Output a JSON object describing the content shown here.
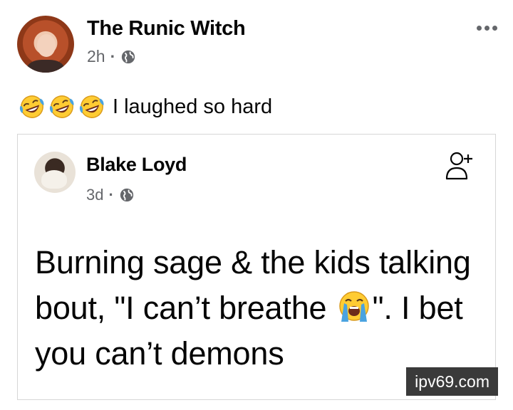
{
  "post": {
    "author": "The Runic Witch",
    "time": "2h",
    "separator": "·",
    "caption": "I laughed so hard",
    "caption_emojis": [
      "rolling-on-floor-laughing-icon",
      "rolling-on-floor-laughing-icon",
      "rolling-on-floor-laughing-icon"
    ],
    "privacy_icon": "globe-icon",
    "more_icon": "more-options-icon"
  },
  "shared_post": {
    "author": "Blake Loyd",
    "time": "3d",
    "separator": "·",
    "privacy_icon": "globe-icon",
    "action_icon": "add-friend-icon",
    "text_before_emoji": "Burning sage & the kids talking bout, \"I can’t breathe ",
    "text_after_emoji": "\". I bet you can’t demons",
    "emoji": "loudly-crying-face-icon"
  },
  "watermark": "ipv69.com",
  "colors": {
    "text": "#050505",
    "secondary_text": "#65676b",
    "card_border": "#d6d6d6",
    "watermark_bg": "#3a3a3a",
    "emoji_yellow": "#ffcc33",
    "tear_blue": "#4aa3e0"
  }
}
